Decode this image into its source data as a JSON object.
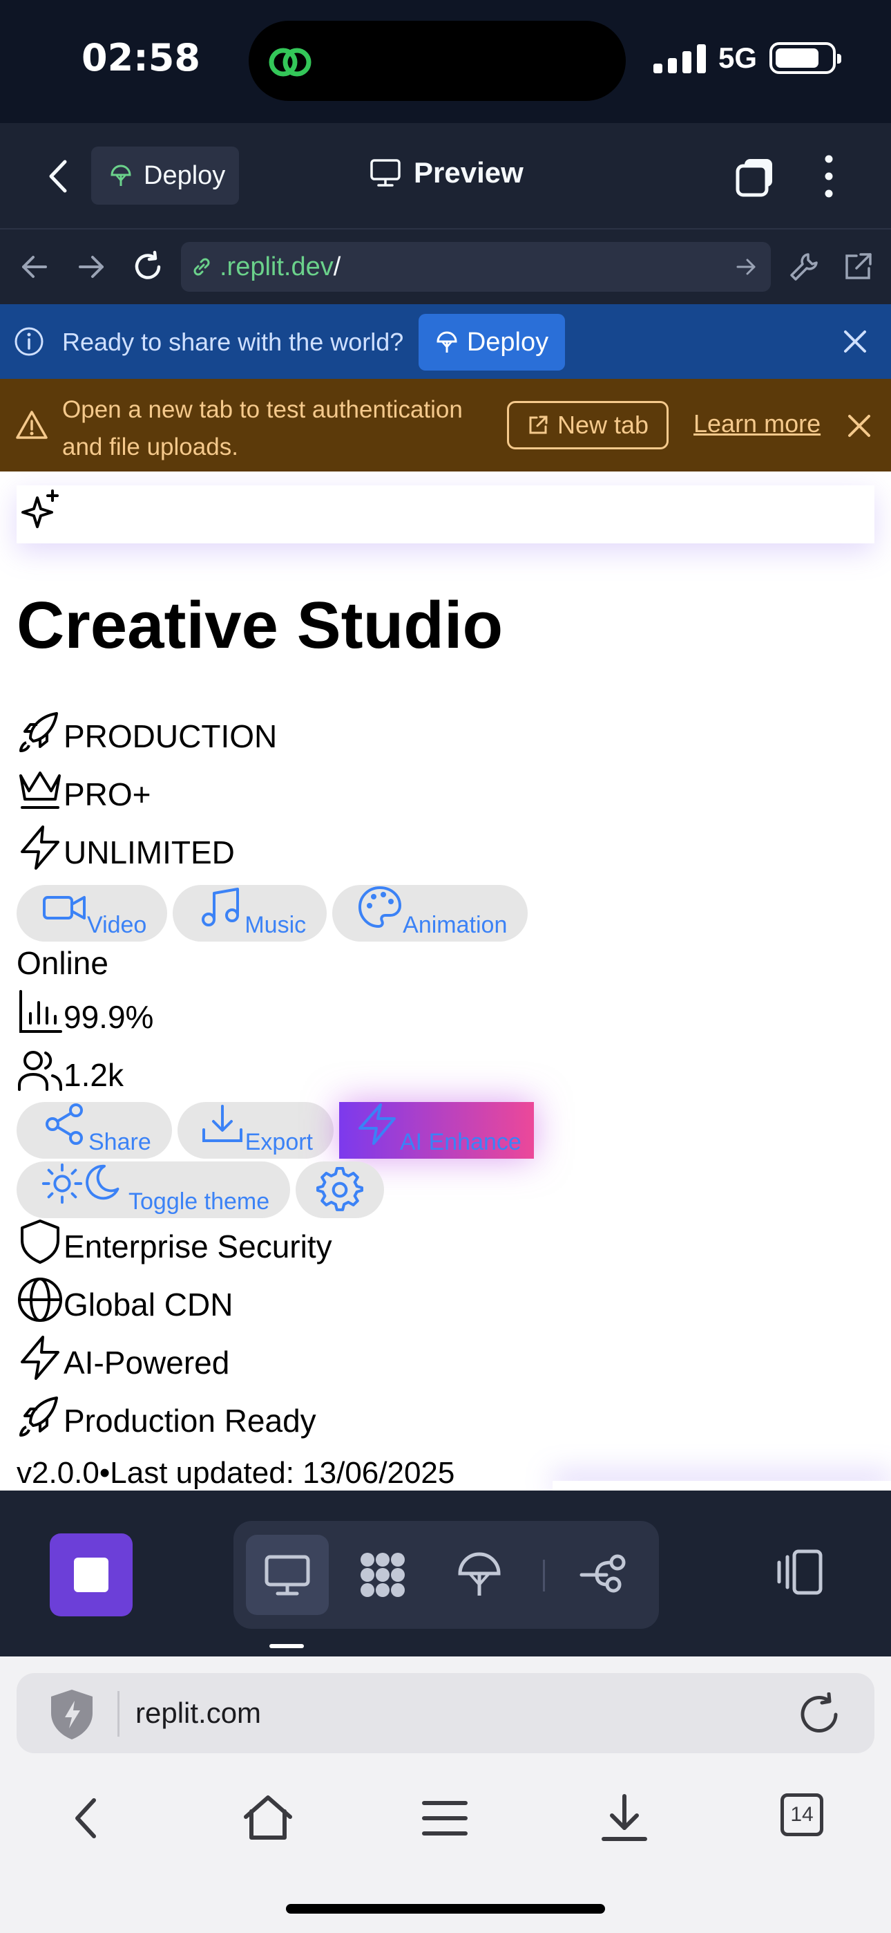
{
  "status": {
    "time": "02:58",
    "network": "5G"
  },
  "replit_header": {
    "deploy_label": "Deploy",
    "preview_label": "Preview"
  },
  "url_bar": {
    "url": ".replit.dev",
    "slash": "/"
  },
  "share_banner": {
    "text": "Ready to share with the world?",
    "deploy_label": "Deploy"
  },
  "auth_banner": {
    "text": "Open a new tab to test authentication and file uploads.",
    "new_tab_label": "New tab",
    "learn_more_label": "Learn more"
  },
  "app": {
    "title": "Creative Studio",
    "badges": [
      "PRODUCTION",
      "PRO+",
      "UNLIMITED"
    ],
    "categories": [
      "Video",
      "Music",
      "Animation"
    ],
    "status_text": "Online",
    "uptime": "99.9%",
    "users": "1.2k",
    "actions": {
      "share": "Share",
      "export": "Export",
      "ai_enhance": "AI Enhance",
      "toggle_theme": "Toggle theme"
    },
    "features": [
      "Enterprise Security",
      "Global CDN",
      "AI-Powered",
      "Production Ready"
    ],
    "footer": "v2.0.0•Last updated: 13/06/2025"
  },
  "browser": {
    "address": "replit.com",
    "tab_count": "14"
  },
  "colors": {
    "replit_dark": "#1c2333",
    "accent_blue": "#3b82f6",
    "share_banner": "#16478f",
    "auth_banner": "#5c3a0a",
    "purple": "#6c3fd8"
  }
}
